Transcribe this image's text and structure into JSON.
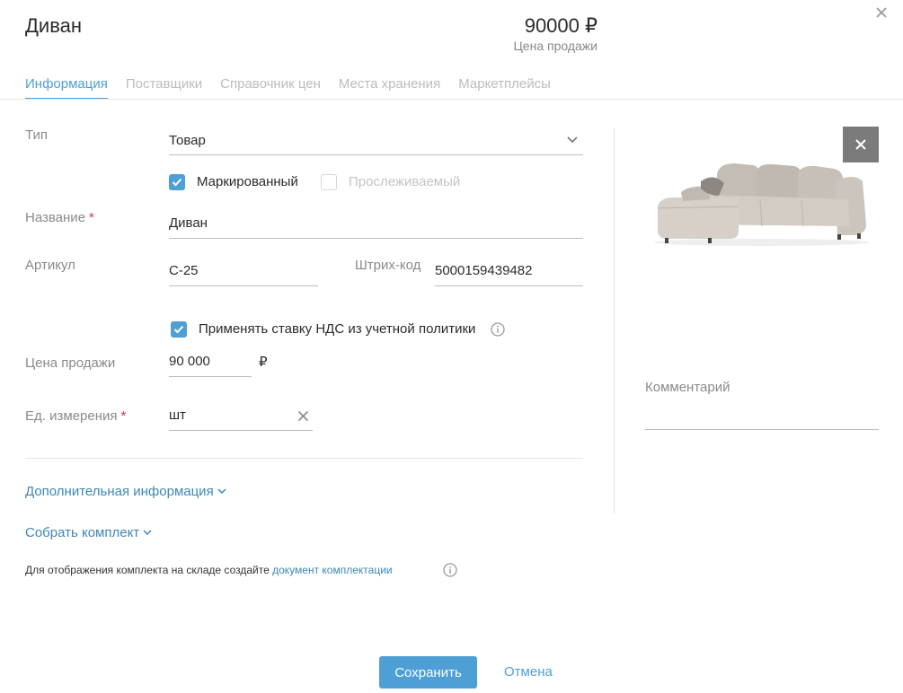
{
  "header": {
    "title": "Диван",
    "price": "90000 ₽",
    "price_caption": "Цена продажи"
  },
  "tabs": [
    {
      "label": "Информация",
      "active": true
    },
    {
      "label": "Поставщики",
      "active": false
    },
    {
      "label": "Справочник цен",
      "active": false
    },
    {
      "label": "Места хранения",
      "active": false
    },
    {
      "label": "Маркетплейсы",
      "active": false
    }
  ],
  "form": {
    "type": {
      "label": "Тип",
      "value": "Товар"
    },
    "marked": {
      "label": "Маркированный",
      "checked": true
    },
    "traceable": {
      "label": "Прослеживаемый",
      "checked": false
    },
    "name": {
      "label": "Название",
      "required_mark": "*",
      "value": "Диван"
    },
    "article": {
      "label": "Артикул",
      "value": "С-25"
    },
    "barcode": {
      "label": "Штрих-код",
      "value": "5000159439482"
    },
    "vat": {
      "label": "Применять ставку НДС из учетной политики",
      "checked": true
    },
    "sale_price": {
      "label": "Цена продажи",
      "value": "90 000",
      "currency": "₽"
    },
    "unit": {
      "label": "Ед. измерения",
      "required_mark": "*",
      "value": "шт"
    }
  },
  "sections": {
    "additional_info": "Дополнительная информация",
    "assemble_kit": "Собрать комплект",
    "kit_note": "Для отображения комплекта на складе создайте",
    "kit_note_link": "документ комплектации"
  },
  "side": {
    "comment_label": "Комментарий",
    "comment_value": ""
  },
  "footer": {
    "save": "Сохранить",
    "cancel": "Отмена"
  },
  "colors": {
    "accent": "#4d9fd6",
    "link": "#3d87b6",
    "required": "#e0314b"
  }
}
